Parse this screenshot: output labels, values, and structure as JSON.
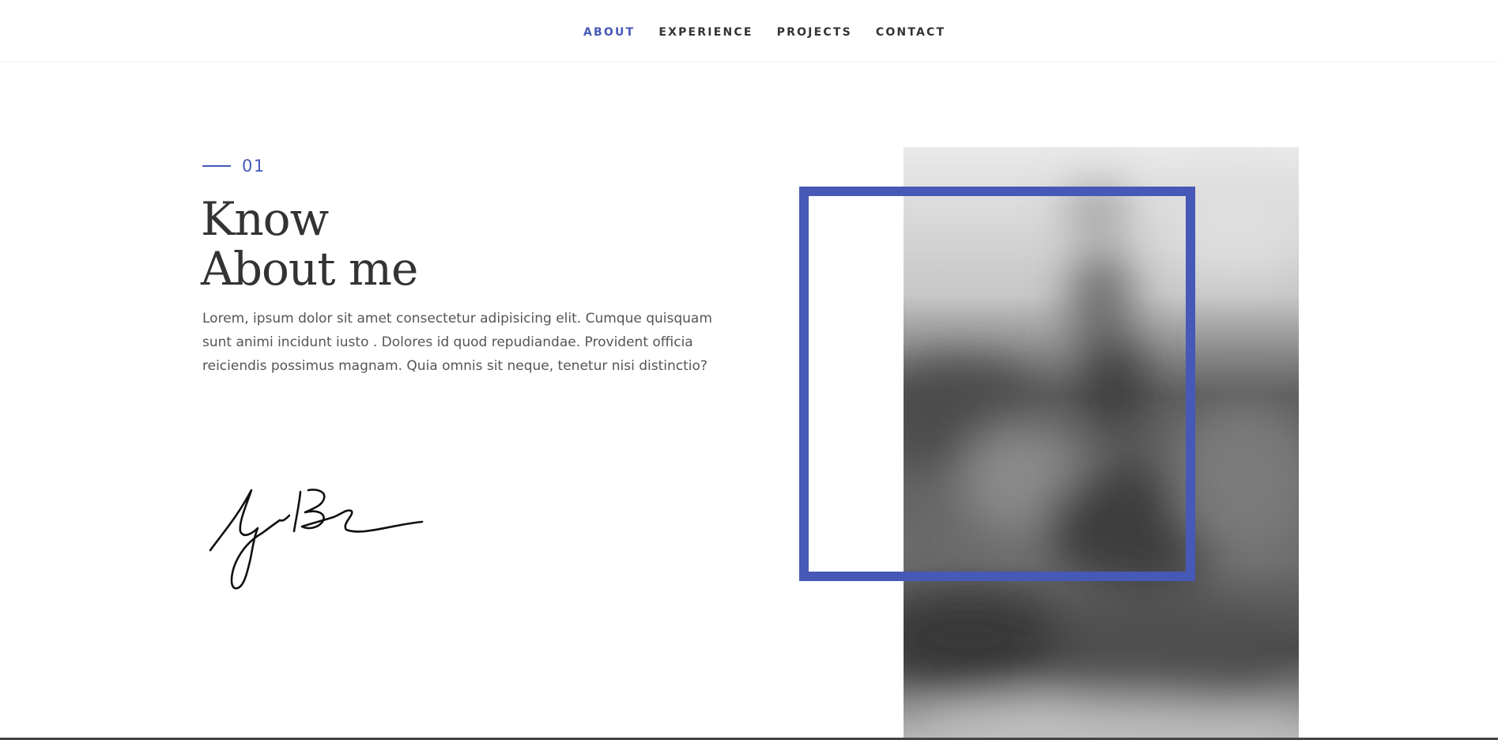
{
  "nav": {
    "items": [
      {
        "label": "ABOUT",
        "active": true
      },
      {
        "label": "EXPERIENCE",
        "active": false
      },
      {
        "label": "PROJECTS",
        "active": false
      },
      {
        "label": "CONTACT",
        "active": false
      }
    ]
  },
  "about": {
    "section_number": "01",
    "heading_line1": "Know",
    "heading_line2": "About me",
    "body": "Lorem, ipsum dolor sit amet consectetur adipisicing elit. Cumque quisquam sunt animi incidunt iusto . Dolores id quod repudiandae. Provident officia reiciendis possimus magnam. Quia omnis sit neque, tenetur nisi distinctio?"
  },
  "colors": {
    "accent": "#4659b7",
    "text_dark": "#333333",
    "text_body": "#555555"
  }
}
